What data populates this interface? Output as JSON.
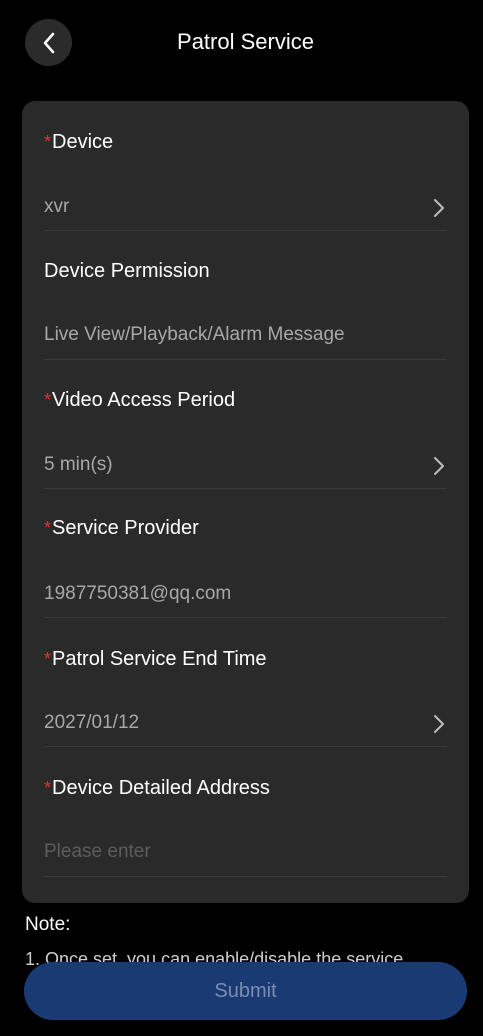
{
  "header": {
    "title": "Patrol Service",
    "back_icon": "chevron-left-icon"
  },
  "form": {
    "fields": [
      {
        "label": "Device",
        "required": true,
        "value": "xvr",
        "has_chevron": true
      },
      {
        "label": "Device Permission",
        "required": false,
        "value": "Live View/Playback/Alarm Message",
        "has_chevron": false
      },
      {
        "label": "Video Access Period",
        "required": true,
        "value": "5 min(s)",
        "has_chevron": true
      },
      {
        "label": "Service Provider",
        "required": true,
        "value": "1987750381@qq.com",
        "has_chevron": false
      },
      {
        "label": "Patrol Service End Time",
        "required": true,
        "value": "2027/01/12",
        "has_chevron": true
      },
      {
        "label": "Device Detailed Address",
        "required": true,
        "value": "",
        "placeholder": "Please enter",
        "has_chevron": false
      }
    ],
    "required_marker": "*"
  },
  "note": {
    "title": "Note:",
    "text": "1. Once set, you can enable/disable the service"
  },
  "submit": {
    "label": "Submit"
  },
  "colors": {
    "background": "#000000",
    "card": "#2a2a2a",
    "required": "#e0332f",
    "submit_bg": "#1a3a73",
    "submit_text": "#7b8cae"
  }
}
